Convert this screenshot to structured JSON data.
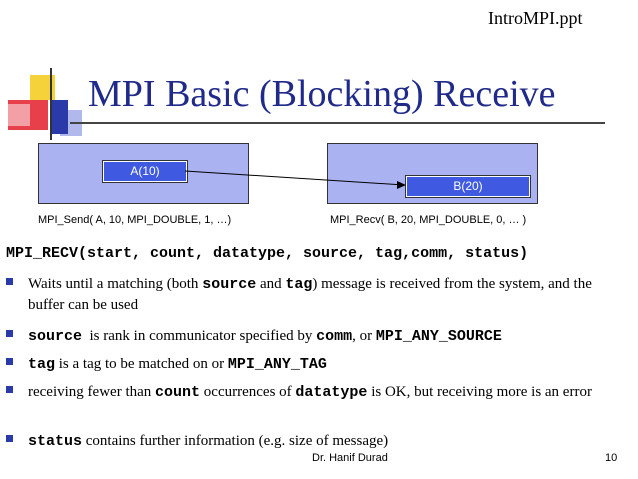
{
  "header": {
    "file_name": "IntroMPI.ppt"
  },
  "title": "MPI Basic (Blocking) Receive",
  "diagram": {
    "buffer_a": "A(10)",
    "buffer_b": "B(20)",
    "send_caption": "MPI_Send( A, 10, MPI_DOUBLE, 1, …)",
    "recv_caption": "MPI_Recv( B, 20, MPI_DOUBLE, 0, … )"
  },
  "signature": "MPI_RECV(start, count, datatype, source, tag,comm, status)",
  "bullets": [
    {
      "t1": "Waits until a matching (both ",
      "c1": "source",
      "t2": " and ",
      "c2": "tag",
      "t3": ") message is received from the system, and the buffer can be used"
    },
    {
      "c1": "source",
      "t1": "  is rank in communicator specified by ",
      "c2": "comm",
      "t2": ", or ",
      "c3": "MPI_ANY_SOURCE"
    },
    {
      "c1": "tag",
      "t1": " is a tag to be matched on or ",
      "c2": "MPI_ANY_TAG"
    },
    {
      "t1": "receiving fewer than ",
      "c1": "count",
      "t2": " occurrences of ",
      "c2": "datatype",
      "t3": " is OK, but receiving more is an error"
    },
    {
      "c1": "status",
      "t1": " contains further information (e.g. size of message)"
    }
  ],
  "footer": {
    "author": "Dr. Hanif Durad",
    "page": "10"
  },
  "colors": {
    "title": "#1f2a8a",
    "box_fill": "#aab2f2",
    "buffer_fill": "#3f5ae0",
    "bullet": "#2a3aa8"
  }
}
